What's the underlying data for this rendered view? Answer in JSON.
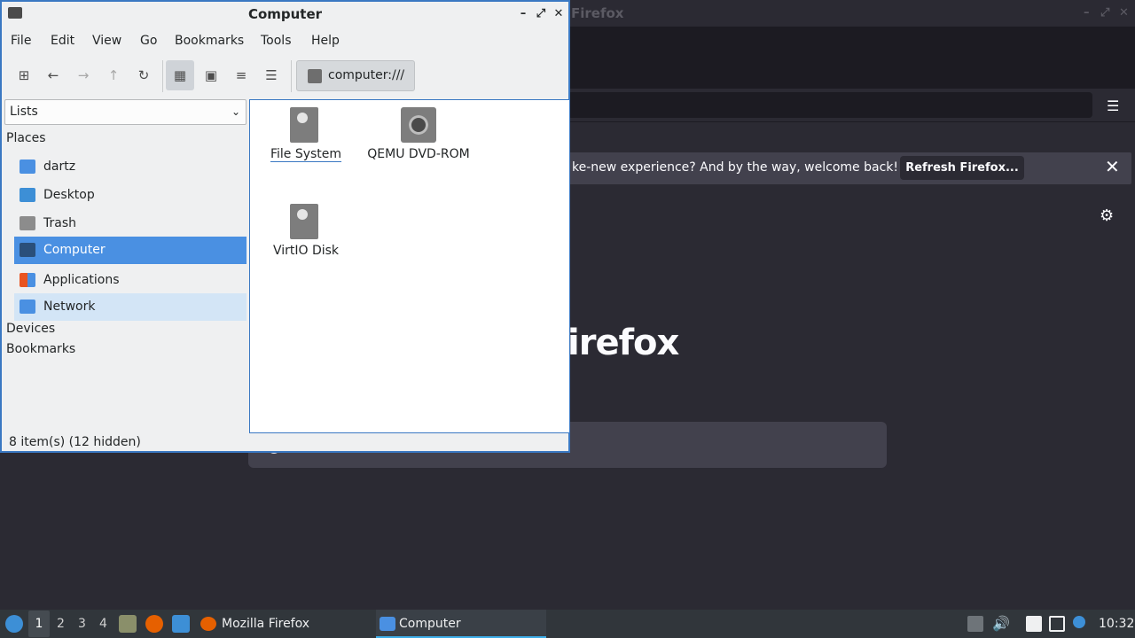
{
  "firefox": {
    "title": "Firefox",
    "notification_text": "ke-new experience? And by the way, welcome back!",
    "refresh_button": "Refresh Firefox...",
    "brand_text": "irefox"
  },
  "window": {
    "title": "Computer",
    "minimize": "–",
    "maximize": "⤢",
    "close": "✕"
  },
  "menubar": {
    "items": [
      "File",
      "Edit",
      "View",
      "Go",
      "Bookmarks",
      "Tools",
      "Help"
    ]
  },
  "toolbar": {
    "location": "computer:///"
  },
  "sidebar": {
    "view_select": "Lists",
    "sections": {
      "places": "Places",
      "devices": "Devices",
      "bookmarks": "Bookmarks"
    },
    "places": [
      {
        "label": "dartz",
        "icon": "home-folder-icon"
      },
      {
        "label": "Desktop",
        "icon": "desktop-icon"
      },
      {
        "label": "Trash",
        "icon": "trash-icon"
      },
      {
        "label": "Computer",
        "icon": "computer-icon"
      },
      {
        "label": "Applications",
        "icon": "applications-icon"
      },
      {
        "label": "Network",
        "icon": "network-icon"
      }
    ]
  },
  "content": {
    "items": [
      {
        "label": "File System",
        "icon": "drive-icon"
      },
      {
        "label": "QEMU DVD-ROM",
        "icon": "optical-disc-icon"
      },
      {
        "label": "VirtIO Disk",
        "icon": "drive-icon"
      }
    ]
  },
  "status": "8 item(s) (12 hidden)",
  "taskbar": {
    "workspaces": [
      "1",
      "2",
      "3",
      "4"
    ],
    "tasks": [
      {
        "label": "Mozilla Firefox"
      },
      {
        "label": "Computer"
      }
    ],
    "clock": "10:32"
  },
  "colors": {
    "accent": "#3a78c2",
    "selection": "#4a90e2",
    "firefox_bg": "#2b2a33"
  }
}
